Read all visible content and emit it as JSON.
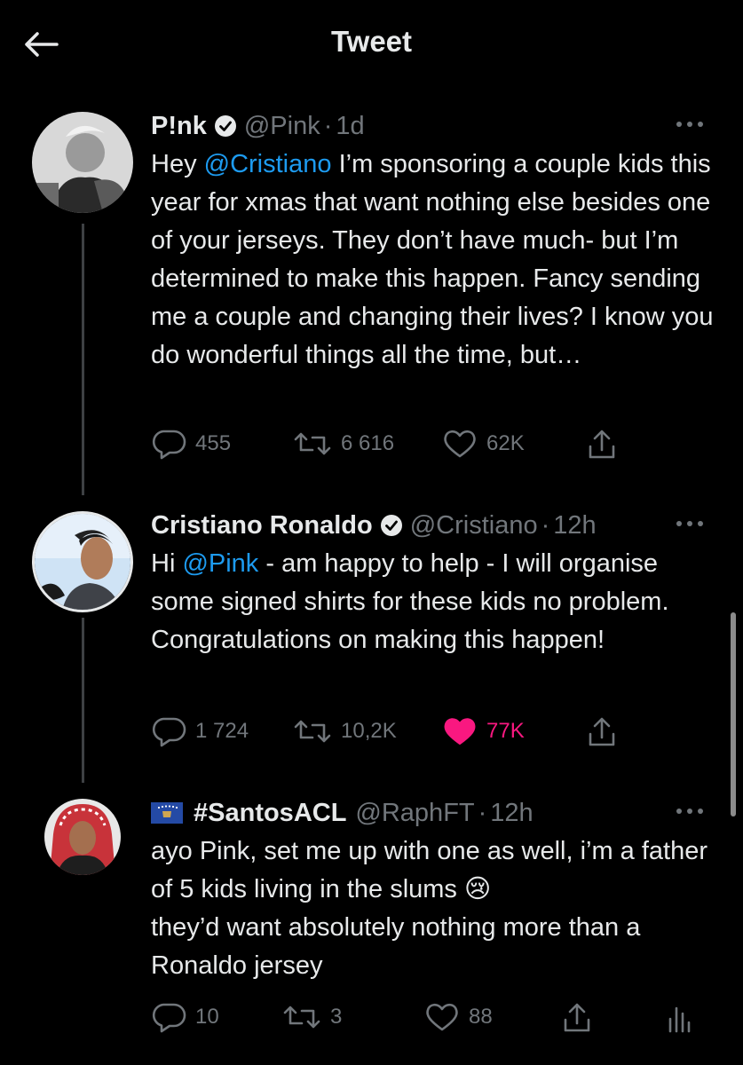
{
  "header": {
    "title": "Tweet"
  },
  "tweets": [
    {
      "name": "P!nk",
      "handle": "@Pink",
      "time": "1d",
      "text_parts": [
        "Hey ",
        "@Cristiano",
        " I’m sponsoring a couple kids this year for xmas that want nothing else besides one of your jerseys. They don’t have much- but I’m determined to make this happen. Fancy sending me a couple and changing their lives? I know you do wonderful things all the time, but…"
      ],
      "replies": "455",
      "retweets": "6 616",
      "likes": "62K",
      "liked": false
    },
    {
      "name": "Cristiano Ronaldo",
      "handle": "@Cristiano",
      "time": "12h",
      "text_parts": [
        "Hi ",
        "@Pink",
        " - am happy to help - I will organise some signed shirts for these kids no problem.",
        "Congratulations on making this happen!"
      ],
      "replies": "1 724",
      "retweets": "10,2K",
      "likes": "77K",
      "liked": true
    },
    {
      "name": "#SantosACL",
      "handle": "@RaphFT",
      "time": "12h",
      "text_parts": [
        "ayo Pink, set me up with one as well, i’m a father of 5 kids living in the slums 😢",
        "they’d want absolutely nothing more than a Ronaldo jersey"
      ],
      "replies": "10",
      "retweets": "3",
      "likes": "88",
      "liked": false
    }
  ],
  "colors": {
    "background": "#000000",
    "text": "#e7e9ea",
    "muted": "#71767b",
    "link": "#1d9bf0",
    "like": "#f91880"
  }
}
